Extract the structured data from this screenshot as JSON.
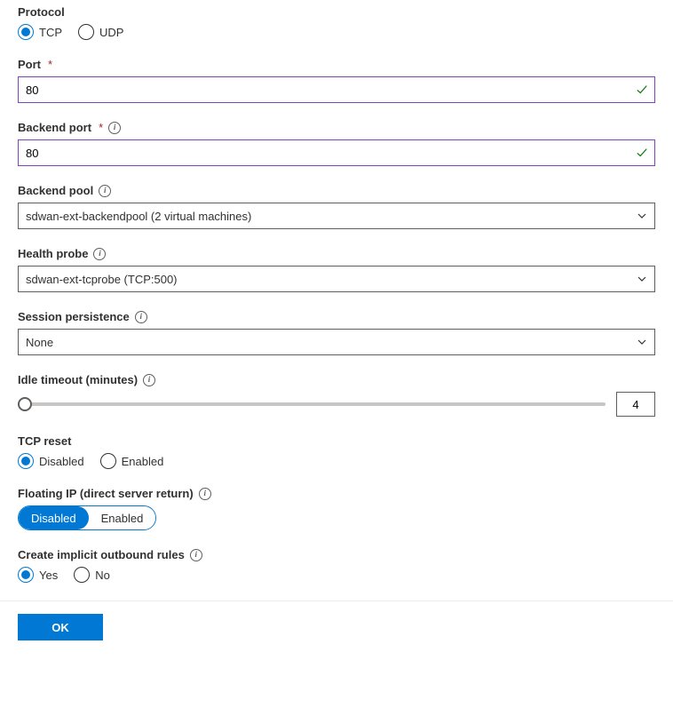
{
  "protocol": {
    "label": "Protocol",
    "options": {
      "tcp": "TCP",
      "udp": "UDP"
    },
    "selected": "tcp"
  },
  "port": {
    "label": "Port",
    "value": "80"
  },
  "backend_port": {
    "label": "Backend port",
    "value": "80"
  },
  "backend_pool": {
    "label": "Backend pool",
    "value": "sdwan-ext-backendpool (2 virtual machines)"
  },
  "health_probe": {
    "label": "Health probe",
    "value": "sdwan-ext-tcprobe (TCP:500)"
  },
  "session_persistence": {
    "label": "Session persistence",
    "value": "None"
  },
  "idle_timeout": {
    "label": "Idle timeout (minutes)",
    "value": "4"
  },
  "tcp_reset": {
    "label": "TCP reset",
    "options": {
      "disabled": "Disabled",
      "enabled": "Enabled"
    },
    "selected": "disabled"
  },
  "floating_ip": {
    "label": "Floating IP (direct server return)",
    "options": {
      "disabled": "Disabled",
      "enabled": "Enabled"
    },
    "selected": "disabled"
  },
  "outbound_rules": {
    "label": "Create implicit outbound rules",
    "options": {
      "yes": "Yes",
      "no": "No"
    },
    "selected": "yes"
  },
  "footer": {
    "ok": "OK"
  },
  "required_mark": "*"
}
